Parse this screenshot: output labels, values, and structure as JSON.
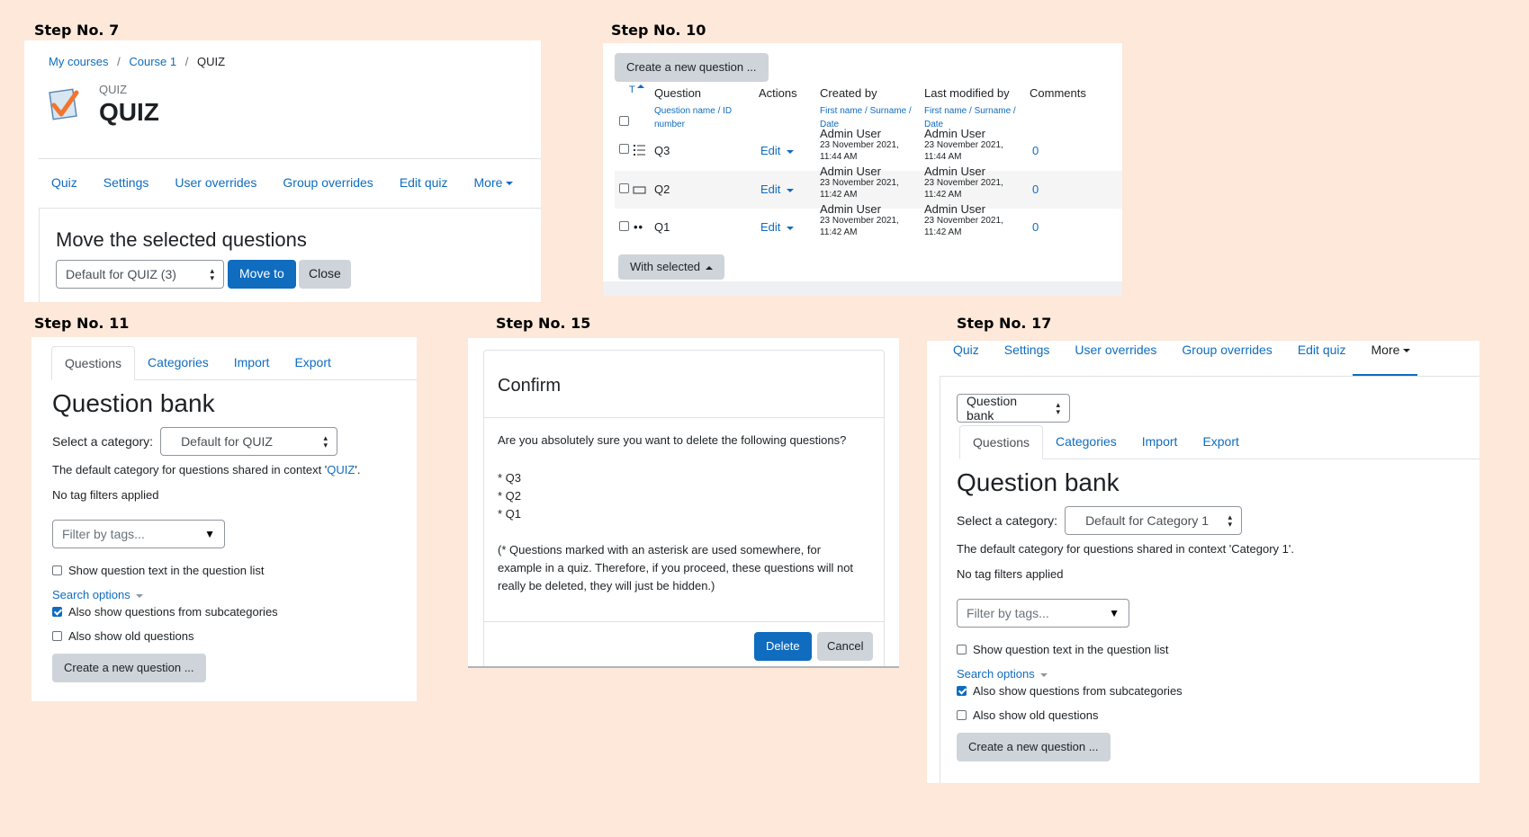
{
  "labels": {
    "s7": "Step No. 7",
    "s10": "Step No. 10",
    "s11": "Step No. 11",
    "s15": "Step No. 15",
    "s17": "Step No. 17"
  },
  "step7": {
    "breadcrumb": [
      "My courses",
      "Course 1",
      "QUIZ"
    ],
    "breadcrumb_sep": "/",
    "page_kind": "QUIZ",
    "page_title": "QUIZ",
    "nav": [
      "Quiz",
      "Settings",
      "User overrides",
      "Group overrides",
      "Edit quiz"
    ],
    "more": "More",
    "move_heading": "Move the selected questions",
    "category_select": "Default for QUIZ (3)",
    "move_btn": "Move to",
    "close_btn": "Close"
  },
  "step10": {
    "create_btn": "Create a new question ...",
    "sort_t": "T",
    "head": {
      "question": "Question",
      "question_sub": "Question name / ID number",
      "actions": "Actions",
      "created": "Created by",
      "created_sub": "First name / Surname / Date",
      "modified": "Last modified by",
      "modified_sub": "First name / Surname / Date",
      "comments": "Comments"
    },
    "rows": [
      {
        "name": "Q3",
        "edit": "Edit",
        "creator": "Admin User",
        "c_date": "23 November 2021,",
        "c_time": "11:44 AM",
        "modifier": "Admin User",
        "m_date": "23 November 2021,",
        "m_time": "11:44 AM",
        "comments": "0",
        "icon": "multichoice-icon"
      },
      {
        "name": "Q2",
        "edit": "Edit",
        "creator": "Admin User",
        "c_date": "23 November 2021,",
        "c_time": "11:42 AM",
        "modifier": "Admin User",
        "m_date": "23 November 2021,",
        "m_time": "11:42 AM",
        "comments": "0",
        "icon": "shortanswer-icon"
      },
      {
        "name": "Q1",
        "edit": "Edit",
        "creator": "Admin User",
        "c_date": "23 November 2021,",
        "c_time": "11:42 AM",
        "modifier": "Admin User",
        "m_date": "23 November 2021,",
        "m_time": "11:42 AM",
        "comments": "0",
        "icon": "truefalse-icon"
      }
    ],
    "with_selected": "With selected"
  },
  "step11": {
    "tabs": [
      "Questions",
      "Categories",
      "Import",
      "Export"
    ],
    "heading": "Question bank",
    "select_label": "Select a category:",
    "category": "Default for QUIZ",
    "default_text_pre": "The default category for questions shared in context '",
    "default_link": "QUIZ",
    "default_text_post": "'.",
    "no_tags": "No tag filters applied",
    "filter_placeholder": "Filter by tags...",
    "show_text": "Show question text in the question list",
    "search_options": "Search options",
    "subcats": "Also show questions from subcategories",
    "old": "Also show old questions",
    "create_btn": "Create a new question ..."
  },
  "step15": {
    "title": "Confirm",
    "question": "Are you absolutely sure you want to delete the following questions?",
    "items": [
      "* Q3",
      "* Q2",
      "* Q1"
    ],
    "note_line1": "(* Questions marked with an asterisk are used somewhere, for",
    "note_line2": "example in a quiz. Therefore, if you proceed, these questions will not",
    "note_line3": "really be deleted, they will just be hidden.)",
    "delete_btn": "Delete",
    "cancel_btn": "Cancel"
  },
  "step17": {
    "nav": [
      "Quiz",
      "Settings",
      "User overrides",
      "Group overrides",
      "Edit quiz"
    ],
    "more": "More",
    "bank_select": "Question bank",
    "tabs": [
      "Questions",
      "Categories",
      "Import",
      "Export"
    ],
    "heading": "Question bank",
    "select_label": "Select a category:",
    "category": "Default for Category 1",
    "default_text": "The default category for questions shared in context 'Category 1'.",
    "no_tags": "No tag filters applied",
    "filter_placeholder": "Filter by tags...",
    "show_text": "Show question text in the question list",
    "search_options": "Search options",
    "subcats": "Also show questions from subcategories",
    "old": "Also show old questions",
    "create_btn": "Create a new question ..."
  },
  "colors": {
    "background": "#fde8d9",
    "primary": "#0f6cbf",
    "secondary": "#ced4da",
    "quiz_icon_orange": "#f0752f"
  }
}
